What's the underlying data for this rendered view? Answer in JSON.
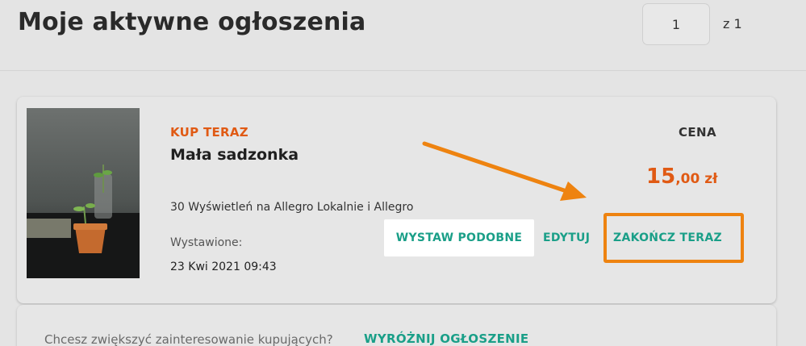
{
  "header": {
    "title": "Moje aktywne ogłoszenia",
    "pagination": {
      "current_page": "1",
      "total_label": "z 1"
    }
  },
  "listing": {
    "badge": "KUP TERAZ",
    "title": "Mała sadzonka",
    "views": "30 Wyświetleń na Allegro Lokalnie i Allegro",
    "listed_label": "Wystawione:",
    "listed_date": "23 Kwi 2021 09:43",
    "price_label": "CENA",
    "price_main": "15",
    "price_fraction": ",00 zł",
    "actions": {
      "similar": "WYSTAW PODOBNE",
      "edit": "EDYTUJ",
      "end": "ZAKOŃCZ TERAZ"
    },
    "thumbnail": "plant-sprout-in-pot-photo"
  },
  "promo": {
    "text": "Chcesz zwiększyć zainteresowanie kupujących?",
    "link": "WYRÓŻNIJ OGŁOSZENIE"
  },
  "colors": {
    "accent_orange": "#e05a14",
    "action_teal": "#1a9f88",
    "annotation_orange": "#ee8310",
    "background": "#e4e4e4"
  },
  "annotation": {
    "arrow_icon": "arrow-annotation-icon",
    "highlight": "end-now-highlight"
  }
}
